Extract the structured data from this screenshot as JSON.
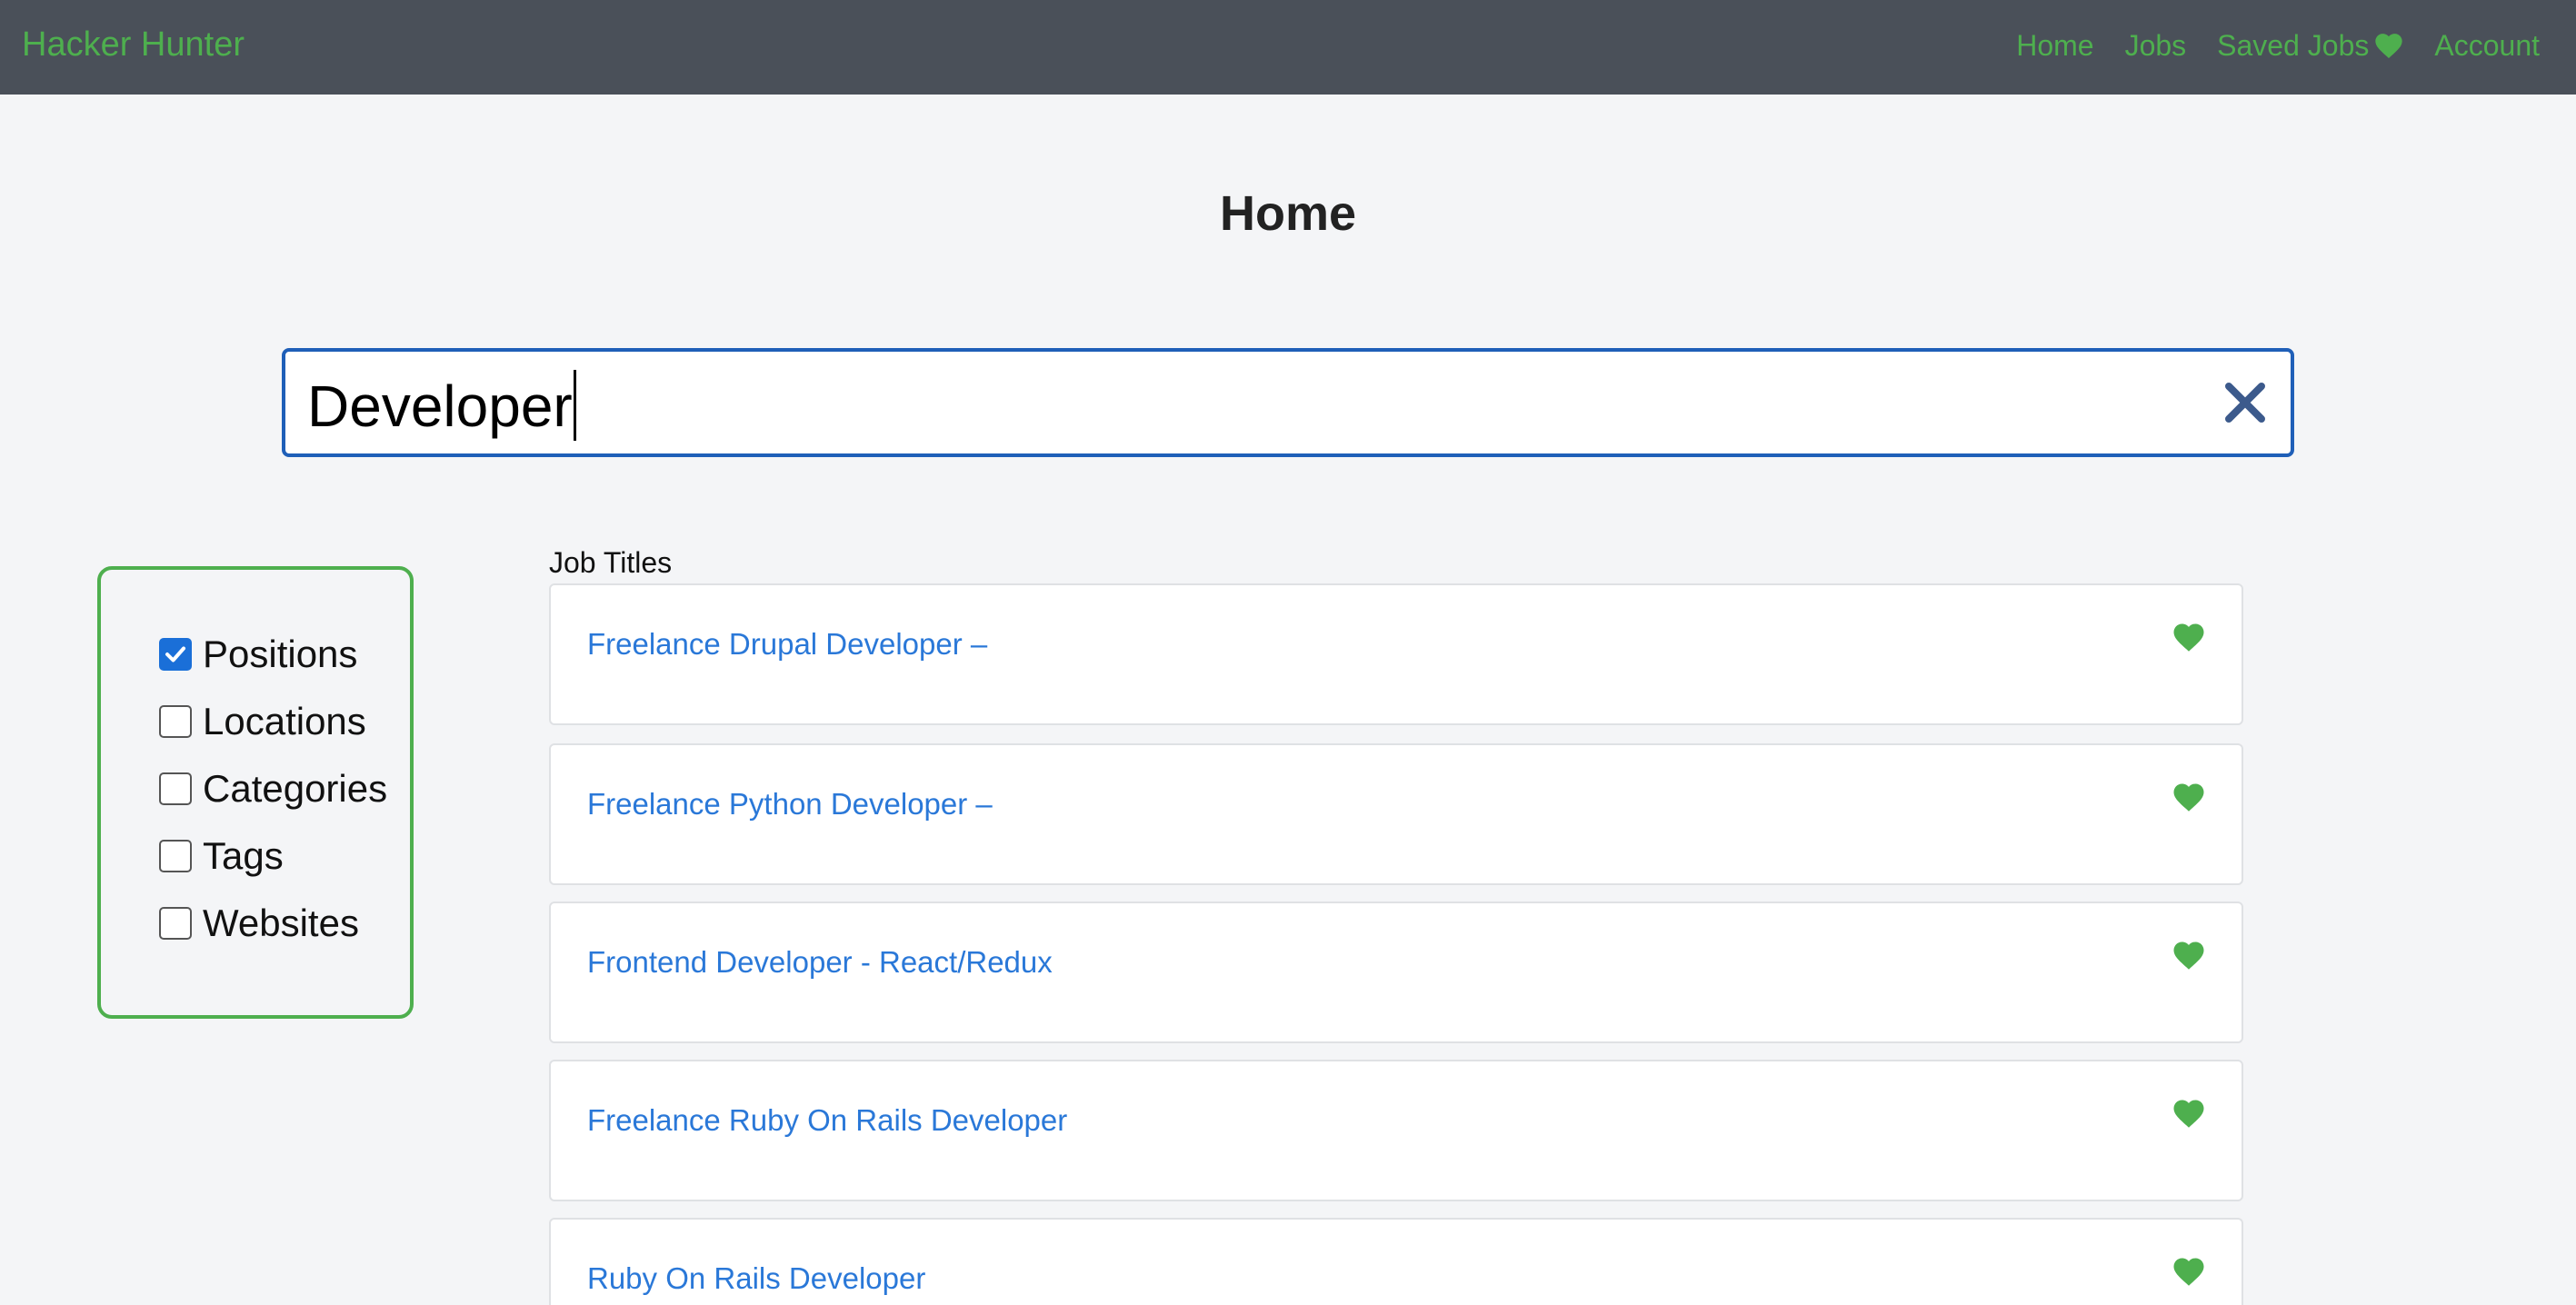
{
  "navbar": {
    "brand": "Hacker Hunter",
    "links": [
      {
        "label": "Home"
      },
      {
        "label": "Jobs"
      },
      {
        "label": "Saved Jobs",
        "icon": "heart-icon"
      },
      {
        "label": "Account"
      }
    ]
  },
  "page": {
    "title": "Home"
  },
  "search": {
    "value": "Developer",
    "clear_icon": "close-icon"
  },
  "filters": [
    {
      "label": "Positions",
      "checked": true
    },
    {
      "label": "Locations",
      "checked": false
    },
    {
      "label": "Categories",
      "checked": false
    },
    {
      "label": "Tags",
      "checked": false
    },
    {
      "label": "Websites",
      "checked": false
    }
  ],
  "results": {
    "header": "Job Titles",
    "jobs": [
      {
        "title": "Freelance Drupal Developer –"
      },
      {
        "title": "Freelance Python Developer –"
      },
      {
        "title": "Frontend Developer - React/Redux"
      },
      {
        "title": "Freelance Ruby On Rails Developer"
      },
      {
        "title": "Ruby On Rails Developer"
      }
    ]
  },
  "colors": {
    "accent_green": "#4eaf4e",
    "navbar_bg": "#4a5059",
    "link_blue": "#2a78d8",
    "search_border": "#1f5fb8"
  }
}
